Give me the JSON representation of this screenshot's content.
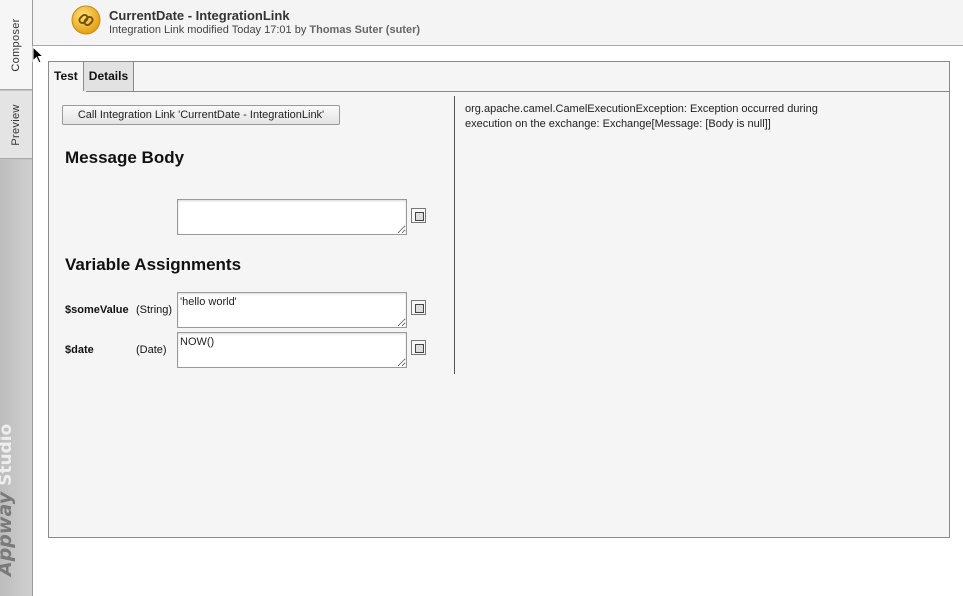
{
  "sidebar": {
    "tabs": [
      {
        "label": "Composer"
      },
      {
        "label": "Preview"
      }
    ],
    "brand": {
      "part1": "Appway",
      "part2": "Studio"
    }
  },
  "header": {
    "icon": "link-icon",
    "title": "CurrentDate - IntegrationLink",
    "meta_prefix": "Integration Link modified Today 17:01 by",
    "meta_user": "Thomas Suter (suter)"
  },
  "tabs": [
    {
      "label": "Test",
      "active": true
    },
    {
      "label": "Details",
      "active": false
    }
  ],
  "test": {
    "call_button": "Call Integration Link 'CurrentDate - IntegrationLink'",
    "message_body": {
      "heading": "Message Body",
      "value": ""
    },
    "variables": {
      "heading": "Variable Assignments",
      "items": [
        {
          "name": "$someValue",
          "type": "(String)",
          "value": "'hello world'"
        },
        {
          "name": "$date",
          "type": "(Date)",
          "value": "NOW()"
        }
      ]
    },
    "result": "org.apache.camel.CamelExecutionException: Exception occurred during execution on the exchange: Exchange[Message: [Body is null]]"
  },
  "colors": {
    "accent_icon": "#f2b51b",
    "sidebar": "#c4c4c4",
    "panel": "#f5f5f5"
  }
}
